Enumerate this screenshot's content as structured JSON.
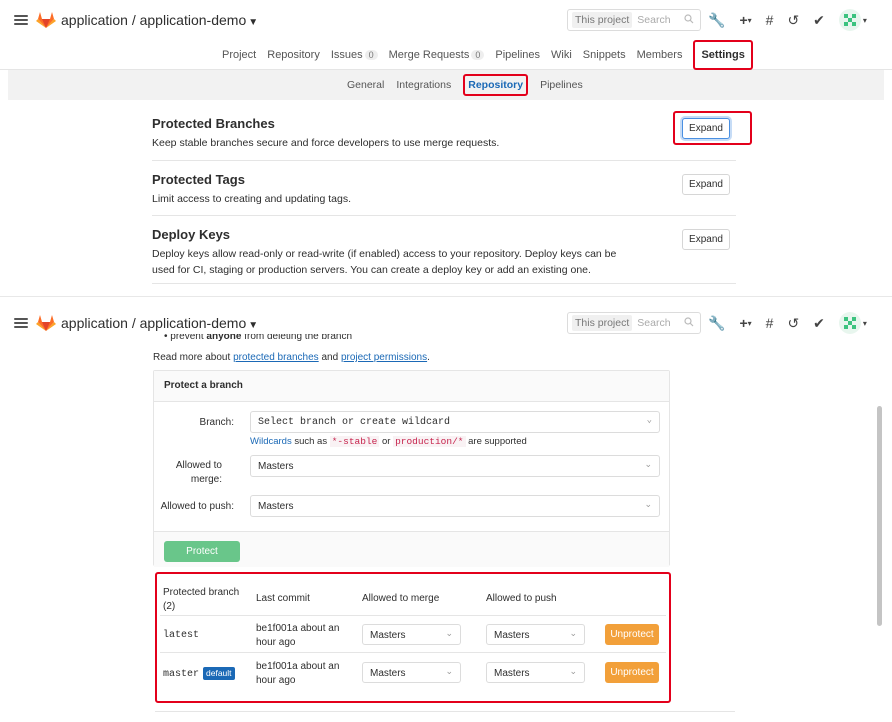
{
  "topbar": {
    "title": "application / application-demo",
    "search_scope": "This project",
    "search_placeholder": "Search"
  },
  "project_nav": {
    "items": [
      "Project",
      "Repository",
      "Issues",
      "Merge Requests",
      "Pipelines",
      "Wiki",
      "Snippets",
      "Members",
      "Settings"
    ],
    "issues_count": "0",
    "mr_count": "0",
    "active": "Settings"
  },
  "settings_nav": {
    "items": [
      "General",
      "Integrations",
      "Repository",
      "Pipelines"
    ],
    "active": "Repository"
  },
  "sections": [
    {
      "title": "Protected Branches",
      "description": "Keep stable branches secure and force developers to use merge requests.",
      "button": "Expand"
    },
    {
      "title": "Protected Tags",
      "description": "Limit access to creating and updating tags.",
      "button": "Expand"
    },
    {
      "title": "Deploy Keys",
      "description": "Deploy keys allow read-only or read-write (if enabled) access to your repository. Deploy keys can be used for CI, staging or production servers. You can create a deploy key or add an existing one.",
      "button": "Expand"
    }
  ],
  "expanded": {
    "bullet_prefix": "prevent ",
    "bullet_bold": "anyone",
    "bullet_suffix": " from deleting the branch",
    "read_more_prefix": "Read more about ",
    "read_more_link1": "protected branches",
    "read_more_mid": " and ",
    "read_more_link2": "project permissions",
    "read_more_suffix": ".",
    "panel_title": "Protect a branch",
    "branch_label": "Branch:",
    "branch_placeholder": "Select branch or create wildcard",
    "wildcard_link": "Wildcards",
    "wildcard_mid1": " such as ",
    "wildcard_code1": "*-stable",
    "wildcard_mid2": " or ",
    "wildcard_code2": "production/*",
    "wildcard_suffix": " are supported",
    "merge_label": "Allowed to merge:",
    "merge_value": "Masters",
    "push_label": "Allowed to push:",
    "push_value": "Masters",
    "protect_button": "Protect"
  },
  "protected_table": {
    "headers": [
      "Protected branch (2)",
      "Last commit",
      "Allowed to merge",
      "Allowed to push"
    ],
    "rows": [
      {
        "branch": "latest",
        "default": "",
        "commit": "be1f001a about an hour ago",
        "merge": "Masters",
        "push": "Masters",
        "action": "Unprotect"
      },
      {
        "branch": "master",
        "default": "default",
        "commit": "be1f001a about an hour ago",
        "merge": "Masters",
        "push": "Masters",
        "action": "Unprotect"
      }
    ]
  },
  "colors": {
    "highlight": "#e3001b",
    "link": "#1b69b6",
    "protect_button": "#69c68a",
    "unprotect_button": "#f2a03a"
  }
}
